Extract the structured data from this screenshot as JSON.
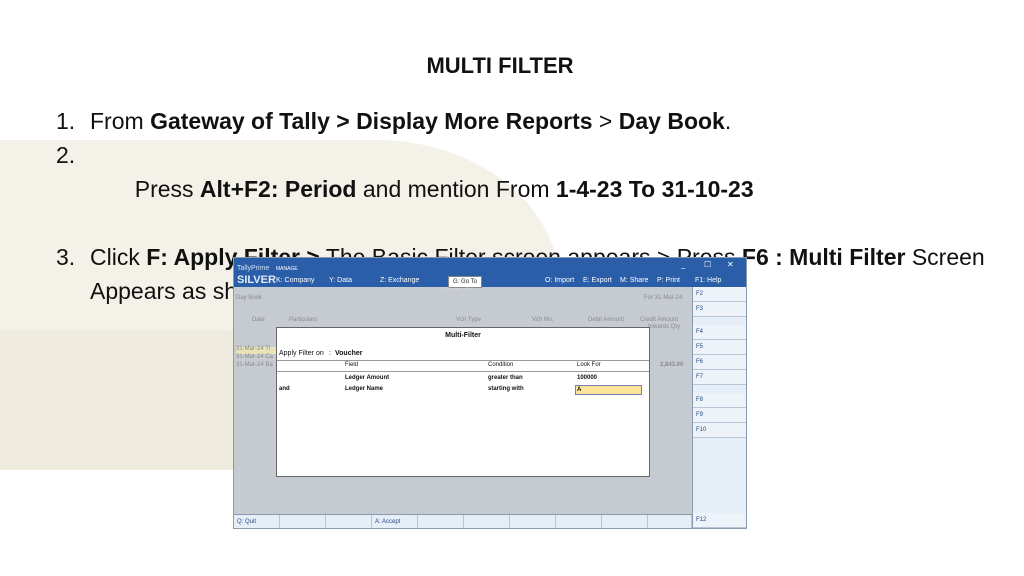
{
  "slide": {
    "title": "MULTI FILTER",
    "steps": [
      {
        "num": "1.",
        "parts": [
          "From ",
          "Gateway of Tally > Display More Reports",
          " > ",
          "Day Book",
          "."
        ]
      },
      {
        "num": "2.",
        "parts": [
          " Press ",
          "Alt+F2: Period",
          " and mention From ",
          "1-4-23 To 31-10-23"
        ]
      },
      {
        "num": "3.",
        "parts": [
          " Click ",
          "F: Apply Filter >",
          " The Basic Filter screen appears > Press ",
          "F6 : Multi Filter",
          " Screen Appears as shown"
        ]
      }
    ]
  },
  "tally": {
    "logo_top": "TallyPrime",
    "logo_edition": "SILVER",
    "manage": "MANAGE",
    "menu": [
      "K: Company",
      "Y: Data",
      "Z: Exchange",
      "O: Import",
      "E: Export",
      "M: Share",
      "P: Print",
      "F1: Help"
    ],
    "goto": "G: Go To",
    "company": "ITT Trading - (Co)",
    "window_controls": [
      "_",
      "☐",
      "✕"
    ],
    "bg": {
      "title": "Day Book",
      "period": "For 31-Mar-24",
      "cols": [
        "Date",
        "Particulars",
        "Vch Type",
        "Vch No.",
        "Debit Amount",
        "Credit Amount"
      ],
      "sub": "Inwards Qty",
      "rows": [
        "31-Mar-24  Ti",
        "31-Mar-24  Ca",
        "31-Mar-24  Ba"
      ],
      "amount": "2,843.00"
    },
    "dialog": {
      "title": "Multi-Filter",
      "apply_label": "Apply Filter on",
      "apply_colon": ":",
      "apply_value": "Voucher",
      "headers": {
        "field": "Field",
        "condition": "Condition",
        "look_for": "Look For"
      },
      "rows": [
        {
          "conj": "",
          "field": "Ledger Amount",
          "condition": "greater than",
          "look_for": "100000"
        },
        {
          "conj": "and",
          "field": "Ledger Name",
          "condition": "starting with",
          "look_for": "A"
        }
      ]
    },
    "right_keys": [
      "F2",
      "F3",
      "F4",
      "F5",
      "F6",
      "F7",
      "F8",
      "F9",
      "F10",
      "F12"
    ],
    "bottom": {
      "quit": "Q: Quit",
      "accept": "A: Accept"
    }
  }
}
